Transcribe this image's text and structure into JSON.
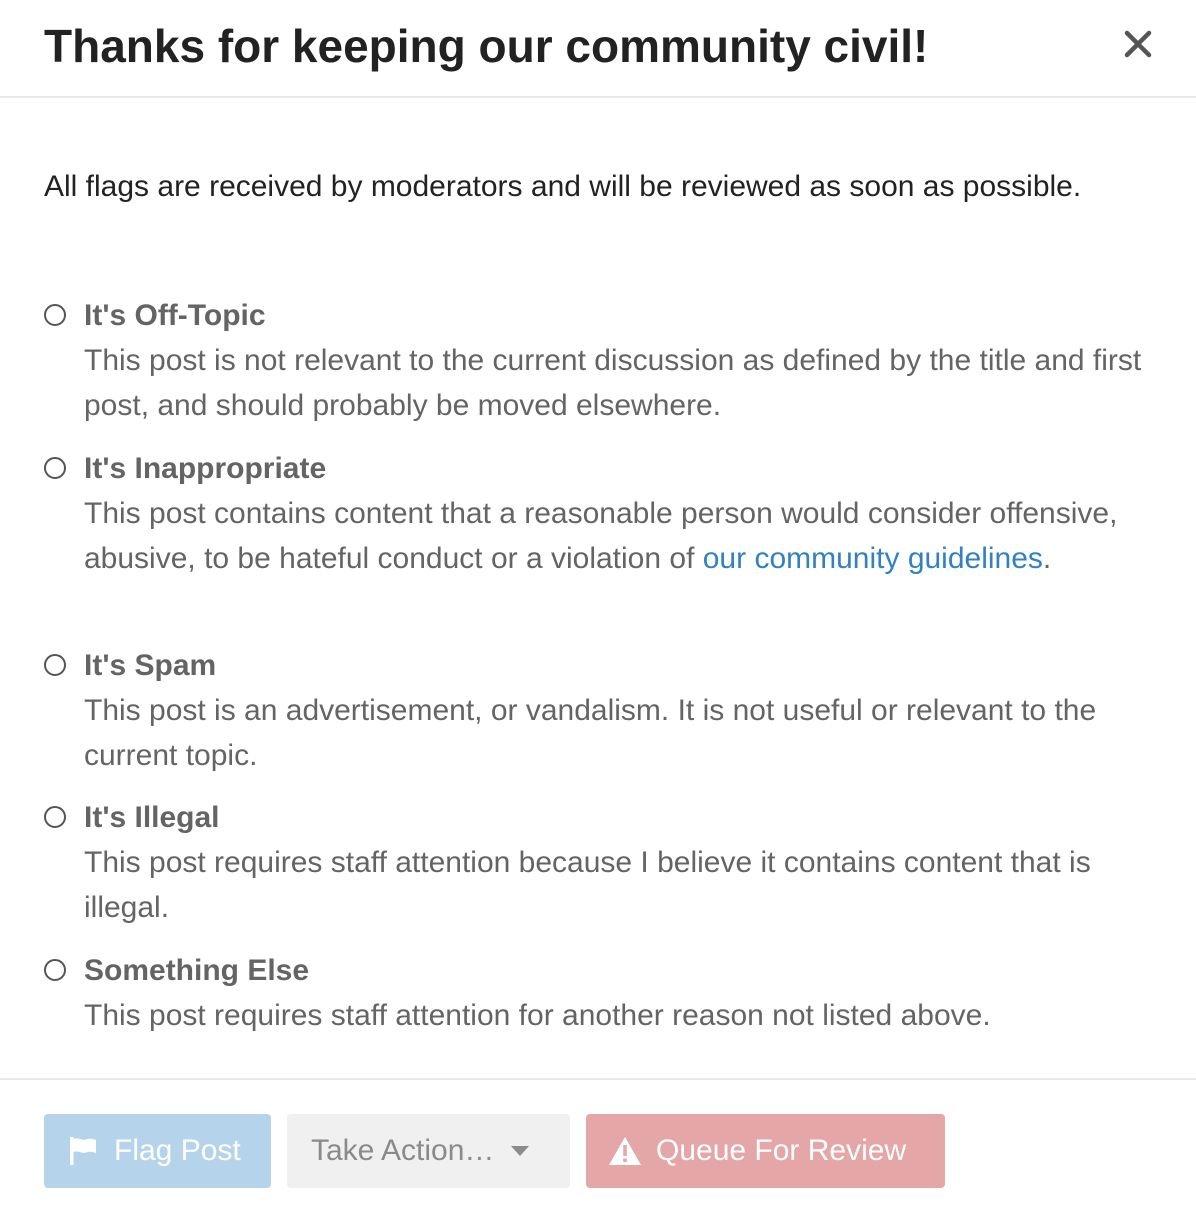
{
  "modal": {
    "title": "Thanks for keeping our community civil!",
    "close_label": "Close"
  },
  "body": {
    "intro": "All flags are received by moderators and will be reviewed as soon as possible."
  },
  "options": [
    {
      "title": "It's Off-Topic",
      "description": "This post is not relevant to the current discussion as defined by the title and first post, and should probably be moved elsewhere."
    },
    {
      "title": "It's Inappropriate",
      "description_before": "This post contains content that a reasonable person would consider offensive, abusive, to be hateful conduct or a violation of ",
      "link_text": "our community guidelines",
      "description_after": "."
    },
    {
      "title": "It's Spam",
      "description": "This post is an advertisement, or vandalism. It is not useful or relevant to the current topic."
    },
    {
      "title": "It's Illegal",
      "description": "This post requires staff attention because I believe it contains content that is illegal."
    },
    {
      "title": "Something Else",
      "description": "This post requires staff attention for another reason not listed above."
    }
  ],
  "footer": {
    "flag_post_label": "Flag Post",
    "take_action_label": "Take Action…",
    "queue_review_label": "Queue For Review"
  },
  "icons": {
    "close": "close-icon",
    "flag": "flag-icon",
    "caret": "caret-down-icon",
    "warning": "warning-icon"
  },
  "colors": {
    "link": "#3181c4",
    "flag_button": "#b5d4ec",
    "action_button": "#f0f0f0",
    "queue_button": "#e4a6a6",
    "option_text": "#646464"
  }
}
